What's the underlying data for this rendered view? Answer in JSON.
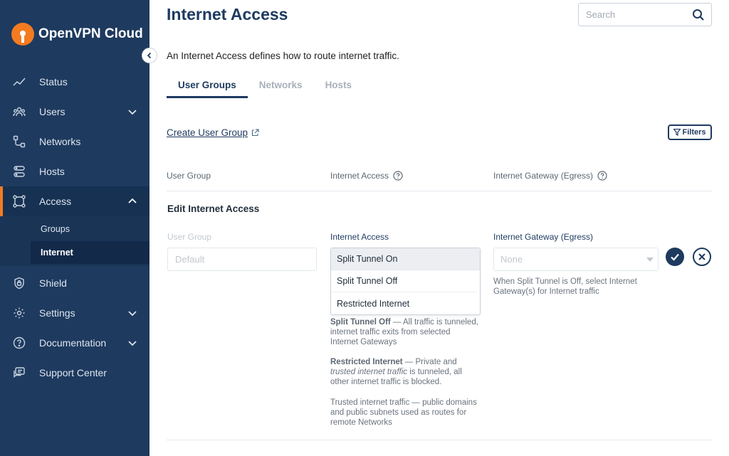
{
  "app": {
    "brand": "OpenVPN Cloud"
  },
  "colors": {
    "sidebar_bg": "#1e3a5f",
    "accent": "#f47b20",
    "primary": "#1e3a5f"
  },
  "sidebar": {
    "items": [
      {
        "label": "Status",
        "icon": "activity-icon"
      },
      {
        "label": "Users",
        "icon": "users-icon"
      },
      {
        "label": "Networks",
        "icon": "networks-icon"
      },
      {
        "label": "Hosts",
        "icon": "hosts-icon"
      },
      {
        "label": "Access",
        "icon": "access-icon"
      },
      {
        "label": "Shield",
        "icon": "shield-icon"
      },
      {
        "label": "Settings",
        "icon": "gear-icon"
      },
      {
        "label": "Documentation",
        "icon": "question-icon"
      },
      {
        "label": "Support Center",
        "icon": "support-icon"
      }
    ],
    "access_sub": [
      {
        "label": "Groups"
      },
      {
        "label": "Internet"
      }
    ]
  },
  "page": {
    "title": "Internet Access",
    "description": "An Internet Access defines how to route internet traffic.",
    "search_placeholder": "Search",
    "tabs": [
      "User Groups",
      "Networks",
      "Hosts"
    ],
    "create_link": "Create User Group",
    "filters_label": "Filters",
    "columns": [
      "User Group",
      "Internet Access",
      "Internet Gateway (Egress)"
    ]
  },
  "edit": {
    "title": "Edit Internet Access",
    "user_group_label": "User Group",
    "user_group_placeholder": "Default",
    "access_label": "Internet Access",
    "access_selected": "Split Tunnel On",
    "access_options": [
      "Split Tunnel Off",
      "Restricted Internet"
    ],
    "gateway_label": "Internet Gateway (Egress)",
    "gateway_value": "None",
    "gateway_help": "When Split Tunnel is Off, select Internet Gateway(s) for Internet traffic",
    "help1_bold": "Split Tunnel Off",
    "help1_text": " — All traffic is tunneled, internet traffic exits from selected Internet Gateways",
    "help2_bold": "Restricted Internet",
    "help2_text_a": " — Private and ",
    "help2_italic": "trusted internet traffic",
    "help2_text_b": " is tunneled, all other internet traffic is blocked.",
    "help3": "Trusted internet traffic — public domains and public subnets used as routes for remote Networks"
  }
}
